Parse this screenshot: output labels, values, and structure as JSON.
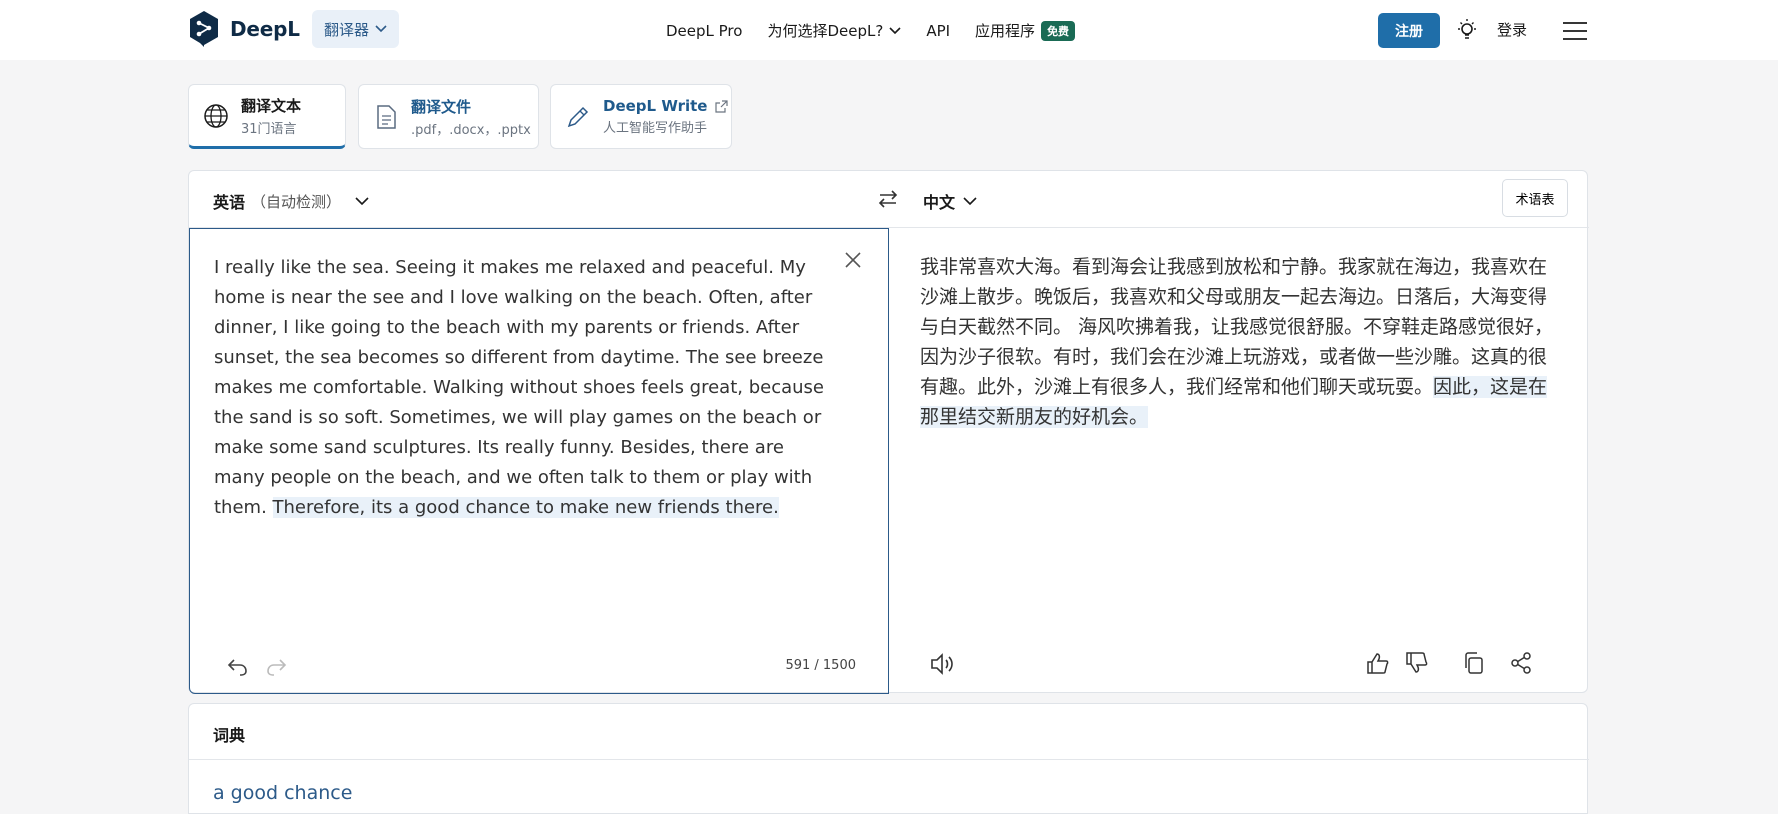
{
  "header": {
    "brand": "DeepL",
    "translator_dropdown": "翻译器",
    "nav": [
      {
        "label": "DeepL Pro"
      },
      {
        "label": "为何选择DeepL?"
      },
      {
        "label": "API"
      },
      {
        "label": "应用程序",
        "badge": "免费"
      }
    ],
    "signup": "注册",
    "login": "登录"
  },
  "modes": [
    {
      "title": "翻译文本",
      "subtitle": "31门语言",
      "icon": "globe-icon"
    },
    {
      "title": "翻译文件",
      "subtitle": ".pdf，.docx，.pptx",
      "icon": "document-icon"
    },
    {
      "title": "DeepL Write",
      "subtitle": "人工智能写作助手",
      "icon": "pen-icon"
    }
  ],
  "translator": {
    "source_lang": "英语",
    "source_lang_note": "（自动检测）",
    "target_lang": "中文",
    "glossary_label": "术语表",
    "source_text": "I really like the sea. Seeing it makes me relaxed and peaceful. My home is near the see and I love walking on the beach. Often, after dinner, I like going to the beach with my parents or friends. After sunset, the sea becomes so different from daytime.        The see breeze makes me comfortable. Walking without shoes feels great, because the sand is so soft. Sometimes, we will play games on the beach or make some sand sculptures. Its really funny. Besides, there are many people on the beach, and we often talk to them or play with them.",
    "source_highlight": "Therefore, its a good chance to make new friends there.",
    "char_count": "591 / 1500",
    "target_text": "我非常喜欢大海。看到海会让我感到放松和宁静。我家就在海边，我喜欢在沙滩上散步。晚饭后，我喜欢和父母或朋友一起去海边。日落后，大海变得与白天截然不同。        海风吹拂着我，让我感觉很舒服。不穿鞋走路感觉很好，因为沙子很软。有时，我们会在沙滩上玩游戏，或者做一些沙雕。这真的很有趣。此外，沙滩上有很多人，我们经常和他们聊天或玩耍。",
    "target_highlight": "因此，这是在那里结交新朋友的好机会。"
  },
  "dictionary": {
    "title": "词典",
    "term": "a good chance"
  },
  "colors": {
    "primary": "#1f6ea9",
    "brand_navy": "#0f2b46",
    "free_badge": "#1a6b55",
    "highlight": "#e9f1f9"
  }
}
